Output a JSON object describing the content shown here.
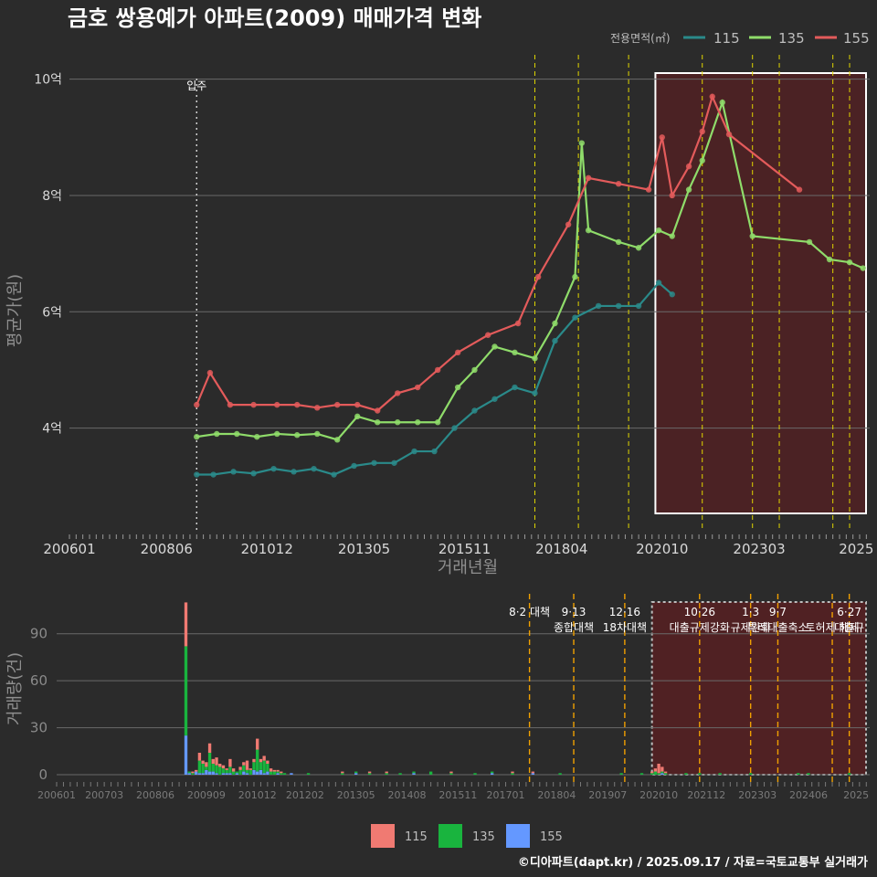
{
  "title": "금호 쌍용예가 아파트(2009) 매매가격 변화",
  "footer": "©디아파트(dapt.kr) / 2025.09.17 / 자료=국토교통부 실거래가",
  "colors": {
    "background": "#2b2b2b",
    "s115": "#2a8a8a",
    "s135": "#8fdc6a",
    "s155": "#e35b5b",
    "bar115": "#f07a72",
    "bar135": "#19b43e",
    "bar155": "#6498ff",
    "policy_line": "#e0d600",
    "bar_policy_line": "#f0a000",
    "highlight_fill": "#5a1f22",
    "move_in_line": "#cfcfcf"
  },
  "top_legend": {
    "title": "전용면적(㎡)",
    "items": [
      {
        "label": "115",
        "color_key": "s115"
      },
      {
        "label": "135",
        "color_key": "s135"
      },
      {
        "label": "155",
        "color_key": "s155"
      }
    ]
  },
  "bottom_legend": {
    "items": [
      {
        "label": "115",
        "color_key": "bar115"
      },
      {
        "label": "135",
        "color_key": "bar135"
      },
      {
        "label": "155",
        "color_key": "bar155"
      }
    ]
  },
  "move_in_label": "입주",
  "chart_data": [
    {
      "type": "line",
      "title": "금호 쌍용예가 아파트(2009) 매매가격 변화",
      "xlabel": "거래년월",
      "ylabel": "평균가(원)",
      "x_ticks": [
        "200601",
        "200806",
        "201012",
        "201305",
        "201511",
        "201804",
        "202010",
        "202303",
        "2025"
      ],
      "y_ticks": [
        "4억",
        "6억",
        "8억",
        "10억"
      ],
      "y_tick_values": [
        4,
        6,
        8,
        10
      ],
      "ylim": [
        2.25,
        10.45
      ],
      "xlim": [
        "2006-01",
        "2025-12"
      ],
      "grid": true,
      "legend_position": "top-right",
      "move_in": "2009-03",
      "policy_dates": [
        "2017-08",
        "2018-09",
        "2019-12",
        "2021-10",
        "2023-01",
        "2023-09",
        "2025-01",
        "2025-06"
      ],
      "highlight_range": [
        "2020-08",
        "2025-12"
      ],
      "series": [
        {
          "name": "115",
          "points": [
            [
              "2009-03",
              3.2
            ],
            [
              "2009-08",
              3.2
            ],
            [
              "2010-02",
              3.25
            ],
            [
              "2010-08",
              3.22
            ],
            [
              "2011-02",
              3.3
            ],
            [
              "2011-08",
              3.25
            ],
            [
              "2012-02",
              3.3
            ],
            [
              "2012-08",
              3.2
            ],
            [
              "2013-02",
              3.35
            ],
            [
              "2013-08",
              3.4
            ],
            [
              "2014-02",
              3.4
            ],
            [
              "2014-08",
              3.6
            ],
            [
              "2015-02",
              3.6
            ],
            [
              "2015-08",
              4.0
            ],
            [
              "2016-02",
              4.3
            ],
            [
              "2016-08",
              4.5
            ],
            [
              "2017-02",
              4.7
            ],
            [
              "2017-08",
              4.6
            ],
            [
              "2018-02",
              5.5
            ],
            [
              "2018-08",
              5.9
            ],
            [
              "2019-03",
              6.1
            ],
            [
              "2019-09",
              6.1
            ],
            [
              "2020-03",
              6.1
            ],
            [
              "2020-09",
              6.5
            ],
            [
              "2021-01",
              6.3
            ]
          ]
        },
        {
          "name": "135",
          "points": [
            [
              "2009-03",
              3.85
            ],
            [
              "2009-09",
              3.9
            ],
            [
              "2010-03",
              3.9
            ],
            [
              "2010-09",
              3.85
            ],
            [
              "2011-03",
              3.9
            ],
            [
              "2011-09",
              3.88
            ],
            [
              "2012-03",
              3.9
            ],
            [
              "2012-09",
              3.8
            ],
            [
              "2013-03",
              4.2
            ],
            [
              "2013-09",
              4.1
            ],
            [
              "2014-03",
              4.1
            ],
            [
              "2014-09",
              4.1
            ],
            [
              "2015-03",
              4.1
            ],
            [
              "2015-09",
              4.7
            ],
            [
              "2016-02",
              5.0
            ],
            [
              "2016-08",
              5.4
            ],
            [
              "2017-02",
              5.3
            ],
            [
              "2017-08",
              5.2
            ],
            [
              "2018-02",
              5.8
            ],
            [
              "2018-08",
              6.6
            ],
            [
              "2018-10",
              8.9
            ],
            [
              "2018-12",
              7.4
            ],
            [
              "2019-09",
              7.2
            ],
            [
              "2020-03",
              7.1
            ],
            [
              "2020-09",
              7.4
            ],
            [
              "2021-01",
              7.3
            ],
            [
              "2021-06",
              8.1
            ],
            [
              "2021-10",
              8.6
            ],
            [
              "2022-04",
              9.6
            ],
            [
              "2023-01",
              7.3
            ],
            [
              "2024-06",
              7.2
            ],
            [
              "2024-12",
              6.9
            ],
            [
              "2025-06",
              6.85
            ],
            [
              "2025-10",
              6.75
            ]
          ]
        },
        {
          "name": "155",
          "points": [
            [
              "2009-03",
              4.4
            ],
            [
              "2009-07",
              4.95
            ],
            [
              "2010-01",
              4.4
            ],
            [
              "2010-08",
              4.4
            ],
            [
              "2011-03",
              4.4
            ],
            [
              "2011-09",
              4.4
            ],
            [
              "2012-03",
              4.35
            ],
            [
              "2012-09",
              4.4
            ],
            [
              "2013-03",
              4.4
            ],
            [
              "2013-09",
              4.3
            ],
            [
              "2014-03",
              4.6
            ],
            [
              "2014-09",
              4.7
            ],
            [
              "2015-03",
              5.0
            ],
            [
              "2015-09",
              5.3
            ],
            [
              "2016-06",
              5.6
            ],
            [
              "2017-03",
              5.8
            ],
            [
              "2017-09",
              6.6
            ],
            [
              "2018-06",
              7.5
            ],
            [
              "2018-12",
              8.3
            ],
            [
              "2019-09",
              8.2
            ],
            [
              "2020-06",
              8.1
            ],
            [
              "2020-10",
              9.0
            ],
            [
              "2021-01",
              8.0
            ],
            [
              "2021-06",
              8.5
            ],
            [
              "2021-10",
              9.1
            ],
            [
              "2022-01",
              9.7
            ],
            [
              "2022-06",
              9.05
            ],
            [
              "2024-03",
              8.1
            ]
          ]
        }
      ]
    },
    {
      "type": "bar",
      "xlabel": "",
      "ylabel": "거래량(건)",
      "x_ticks": [
        "200601",
        "200703",
        "200806",
        "200909",
        "201012",
        "201202",
        "201305",
        "201408",
        "201511",
        "201701",
        "201804",
        "201907",
        "202010",
        "202112",
        "202303",
        "202406",
        "2025"
      ],
      "y_ticks": [
        "0",
        "30",
        "60",
        "90"
      ],
      "ylim": [
        0,
        112
      ],
      "highlight_range": [
        "2020-08",
        "2025-12"
      ],
      "stacked": true,
      "series_order": [
        "155",
        "135",
        "115"
      ],
      "data": [
        {
          "month": "2009-03",
          "s155": 25,
          "s135": 57,
          "s115": 28
        },
        {
          "month": "2009-04",
          "s155": 1,
          "s135": 1,
          "s115": 0
        },
        {
          "month": "2009-05",
          "s155": 0,
          "s135": 1,
          "s115": 1
        },
        {
          "month": "2009-06",
          "s155": 2,
          "s135": 0,
          "s115": 1
        },
        {
          "month": "2009-07",
          "s155": 1,
          "s135": 8,
          "s115": 5
        },
        {
          "month": "2009-08",
          "s155": 1,
          "s135": 6,
          "s115": 2
        },
        {
          "month": "2009-09",
          "s155": 3,
          "s135": 2,
          "s115": 3
        },
        {
          "month": "2009-10",
          "s155": 2,
          "s135": 12,
          "s115": 6
        },
        {
          "month": "2009-11",
          "s155": 2,
          "s135": 5,
          "s115": 3
        },
        {
          "month": "2009-12",
          "s155": 1,
          "s135": 5,
          "s115": 5
        },
        {
          "month": "2010-01",
          "s155": 0,
          "s135": 5,
          "s115": 2
        },
        {
          "month": "2010-02",
          "s155": 1,
          "s135": 3,
          "s115": 2
        },
        {
          "month": "2010-03",
          "s155": 1,
          "s135": 2,
          "s115": 1
        },
        {
          "month": "2010-04",
          "s155": 1,
          "s135": 4,
          "s115": 5
        },
        {
          "month": "2010-05",
          "s155": 0,
          "s135": 2,
          "s115": 2
        },
        {
          "month": "2010-06",
          "s155": 1,
          "s135": 1,
          "s115": 0
        },
        {
          "month": "2010-07",
          "s155": 0,
          "s135": 3,
          "s115": 2
        },
        {
          "month": "2010-08",
          "s155": 2,
          "s135": 4,
          "s115": 2
        },
        {
          "month": "2010-09",
          "s155": 1,
          "s135": 2,
          "s115": 6
        },
        {
          "month": "2010-10",
          "s155": 0,
          "s135": 3,
          "s115": 1
        },
        {
          "month": "2010-11",
          "s155": 3,
          "s135": 5,
          "s115": 2
        },
        {
          "month": "2010-12",
          "s155": 2,
          "s135": 14,
          "s115": 7
        },
        {
          "month": "2011-01",
          "s155": 3,
          "s135": 5,
          "s115": 2
        },
        {
          "month": "2011-02",
          "s155": 1,
          "s135": 8,
          "s115": 3
        },
        {
          "month": "2011-03",
          "s155": 2,
          "s135": 5,
          "s115": 2
        },
        {
          "month": "2011-04",
          "s155": 0,
          "s135": 2,
          "s115": 2
        },
        {
          "month": "2011-05",
          "s155": 0,
          "s135": 2,
          "s115": 1
        },
        {
          "month": "2011-06",
          "s155": 1,
          "s135": 1,
          "s115": 1
        },
        {
          "month": "2011-07",
          "s155": 0,
          "s135": 1,
          "s115": 1
        },
        {
          "month": "2011-08",
          "s155": 0,
          "s135": 1,
          "s115": 0
        },
        {
          "month": "2011-10",
          "s155": 1,
          "s135": 0,
          "s115": 0
        },
        {
          "month": "2012-03",
          "s155": 0,
          "s135": 1,
          "s115": 0
        },
        {
          "month": "2013-01",
          "s155": 0,
          "s135": 1,
          "s115": 1
        },
        {
          "month": "2013-05",
          "s155": 1,
          "s135": 1,
          "s115": 0
        },
        {
          "month": "2013-09",
          "s155": 0,
          "s135": 1,
          "s115": 1
        },
        {
          "month": "2014-02",
          "s155": 0,
          "s135": 1,
          "s115": 1
        },
        {
          "month": "2014-06",
          "s155": 0,
          "s135": 1,
          "s115": 0
        },
        {
          "month": "2014-10",
          "s155": 1,
          "s135": 1,
          "s115": 0
        },
        {
          "month": "2015-03",
          "s155": 0,
          "s135": 2,
          "s115": 0
        },
        {
          "month": "2015-09",
          "s155": 0,
          "s135": 1,
          "s115": 1
        },
        {
          "month": "2016-04",
          "s155": 0,
          "s135": 1,
          "s115": 0
        },
        {
          "month": "2016-09",
          "s155": 1,
          "s135": 1,
          "s115": 0
        },
        {
          "month": "2017-03",
          "s155": 0,
          "s135": 1,
          "s115": 1
        },
        {
          "month": "2017-09",
          "s155": 1,
          "s135": 0,
          "s115": 1
        },
        {
          "month": "2018-05",
          "s155": 0,
          "s135": 1,
          "s115": 0
        },
        {
          "month": "2019-11",
          "s155": 0,
          "s135": 1,
          "s115": 0
        },
        {
          "month": "2020-05",
          "s155": 0,
          "s135": 1,
          "s115": 0
        },
        {
          "month": "2020-08",
          "s155": 0,
          "s135": 1,
          "s115": 1
        },
        {
          "month": "2020-09",
          "s155": 0,
          "s135": 2,
          "s115": 2
        },
        {
          "month": "2020-10",
          "s155": 0,
          "s135": 1,
          "s115": 6
        },
        {
          "month": "2020-11",
          "s155": 1,
          "s135": 1,
          "s115": 3
        },
        {
          "month": "2020-12",
          "s155": 0,
          "s135": 1,
          "s115": 1
        },
        {
          "month": "2021-06",
          "s155": 0,
          "s135": 1,
          "s115": 0
        },
        {
          "month": "2021-10",
          "s155": 0,
          "s135": 1,
          "s115": 0
        },
        {
          "month": "2022-04",
          "s155": 0,
          "s135": 1,
          "s115": 0
        },
        {
          "month": "2023-01",
          "s155": 0,
          "s135": 1,
          "s115": 0
        },
        {
          "month": "2024-03",
          "s155": 0,
          "s135": 1,
          "s115": 0
        },
        {
          "month": "2024-06",
          "s155": 0,
          "s135": 1,
          "s115": 0
        },
        {
          "month": "2025-06",
          "s155": 0,
          "s135": 1,
          "s115": 0
        }
      ],
      "annotations": [
        {
          "date": "2017-08",
          "lines": [
            "8·2 대책"
          ]
        },
        {
          "date": "2018-09",
          "lines": [
            "9·13",
            "종합대책"
          ]
        },
        {
          "date": "2019-12",
          "lines": [
            "12·16",
            "18차대책"
          ]
        },
        {
          "date": "2021-10",
          "lines": [
            "10·26",
            "대출규제강화"
          ]
        },
        {
          "date": "2023-01",
          "lines": [
            "1·3",
            "규제완화"
          ]
        },
        {
          "date": "2023-09",
          "lines": [
            "9·7",
            "특례대출축소"
          ]
        },
        {
          "date": "2025-01",
          "lines": [
            "",
            "토허제 해제"
          ]
        },
        {
          "date": "2025-06",
          "lines": [
            "6·27",
            "대출규"
          ]
        }
      ]
    }
  ]
}
